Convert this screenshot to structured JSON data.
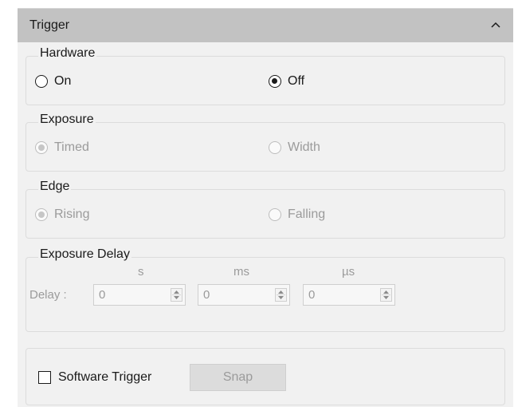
{
  "header": {
    "title": "Trigger",
    "collapse_icon": "chevron-up-icon"
  },
  "hardware": {
    "legend": "Hardware",
    "options": [
      {
        "label": "On",
        "selected": false,
        "enabled": true
      },
      {
        "label": "Off",
        "selected": true,
        "enabled": true
      }
    ]
  },
  "exposure": {
    "legend": "Exposure",
    "options": [
      {
        "label": "Timed",
        "selected": true,
        "enabled": false
      },
      {
        "label": "Width",
        "selected": false,
        "enabled": false
      }
    ]
  },
  "edge": {
    "legend": "Edge",
    "options": [
      {
        "label": "Rising",
        "selected": true,
        "enabled": false
      },
      {
        "label": "Falling",
        "selected": false,
        "enabled": false
      }
    ]
  },
  "exposure_delay": {
    "legend": "Exposure Delay",
    "delay_label": "Delay :",
    "units": [
      "s",
      "ms",
      "µs"
    ],
    "values": [
      "0",
      "0",
      "0"
    ]
  },
  "software": {
    "checkbox_label": "Software Trigger",
    "checked": false,
    "snap_label": "Snap"
  },
  "colors": {
    "header_bg": "#c2c2c2",
    "panel_bg": "#f1f1f1",
    "disabled_text": "#9b9b9b"
  }
}
